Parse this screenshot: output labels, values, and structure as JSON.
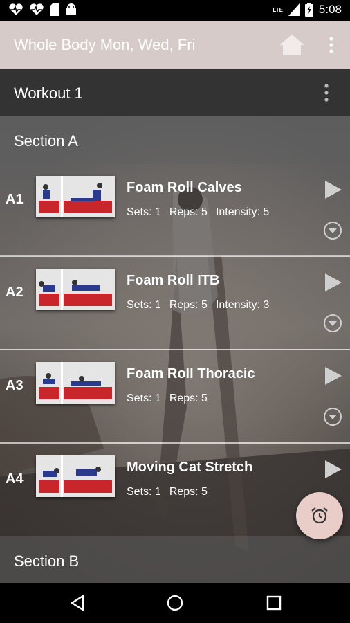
{
  "status_bar": {
    "time": "5:08",
    "network": "LTE",
    "left_icons": [
      "heart-pulse-icon",
      "heart-pulse-icon",
      "sd-card-icon",
      "android-icon"
    ],
    "right_icons": [
      "signal-icon",
      "battery-icon"
    ]
  },
  "app_bar": {
    "title": "Whole Body Mon, Wed, Fri",
    "color": "#d6cbc8",
    "icons": [
      "home-icon",
      "more-vert-icon"
    ]
  },
  "workout": {
    "title": "Workout 1"
  },
  "sections": [
    {
      "label": "Section A",
      "exercises": [
        {
          "code": "A1",
          "name": "Foam Roll Calves",
          "sets": "Sets: 1",
          "reps": "Reps: 5",
          "intensity": "Intensity: 5"
        },
        {
          "code": "A2",
          "name": "Foam Roll ITB",
          "sets": "Sets: 1",
          "reps": "Reps: 5",
          "intensity": "Intensity: 3"
        },
        {
          "code": "A3",
          "name": "Foam Roll Thoracic",
          "sets": "Sets: 1",
          "reps": "Reps: 5",
          "intensity": ""
        },
        {
          "code": "A4",
          "name": "Moving Cat Stretch",
          "sets": "Sets: 1",
          "reps": "Reps: 5",
          "intensity": ""
        }
      ]
    },
    {
      "label": "Section B",
      "exercises": []
    }
  ],
  "fab": {
    "icon": "alarm-icon",
    "color": "#e8cdc8"
  },
  "nav_bar": {
    "icons": [
      "back-icon",
      "home-circle-icon",
      "recents-icon"
    ]
  }
}
